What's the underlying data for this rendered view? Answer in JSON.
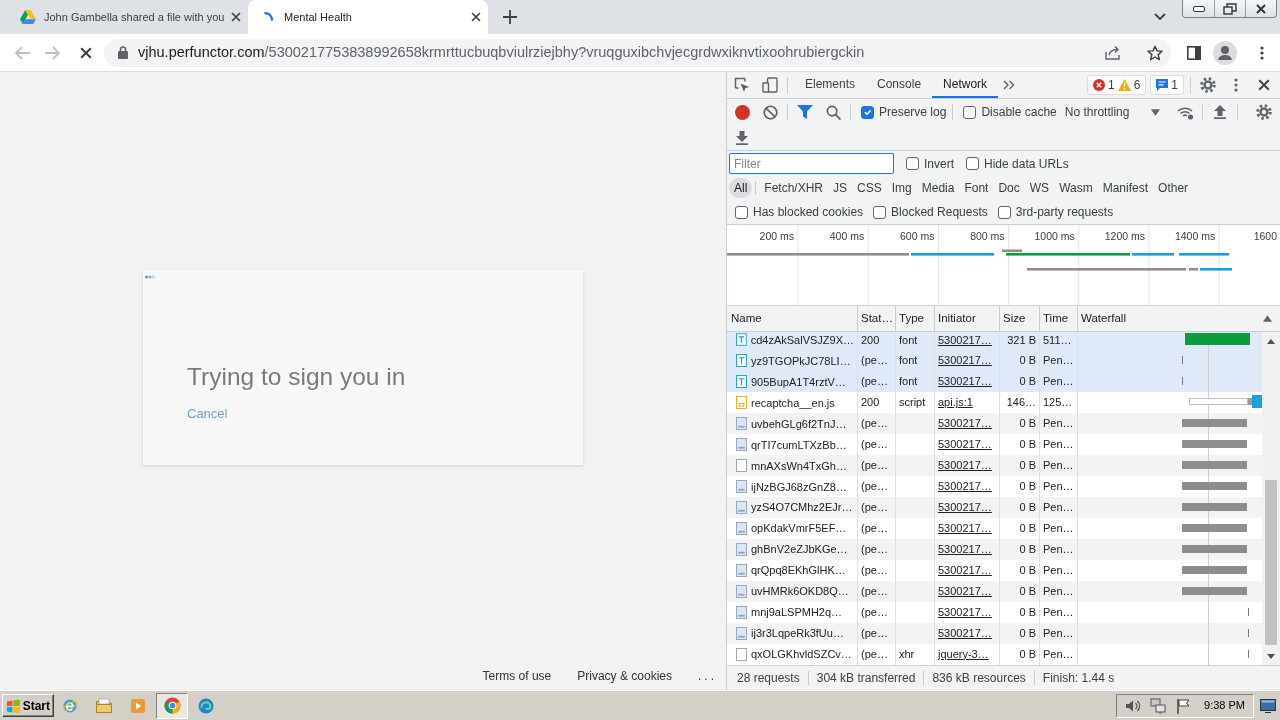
{
  "browser": {
    "tabs": [
      {
        "title": "John Gambella shared a file with you",
        "selected": false,
        "loading": false
      },
      {
        "title": "Mental Health",
        "selected": true,
        "loading": true
      }
    ],
    "nav": {
      "back": {
        "disabled": true
      },
      "forward": {
        "disabled": true
      },
      "loading": true
    },
    "address": {
      "host": "vjhu.perfunctor.com",
      "path": "/5300217753838992658krmrttucbuqbviulrziejbhy?vruqguxibchvjecgrdwxiknvtixoohrubiergckin"
    }
  },
  "page": {
    "status": "Trying to sign you in",
    "cancel": "Cancel",
    "footer": [
      "Terms of use",
      "Privacy & cookies",
      "..."
    ]
  },
  "devtools": {
    "panels": [
      {
        "label": "Elements",
        "selected": false
      },
      {
        "label": "Console",
        "selected": false
      },
      {
        "label": "Network",
        "selected": true
      }
    ],
    "issues": {
      "errors": "1",
      "warnings": "6",
      "messages": "1"
    },
    "toolbar": {
      "recording": true,
      "filter_active": true,
      "options": [
        {
          "label": "Preserve log",
          "checked": true
        },
        {
          "label": "Disable cache",
          "checked": false
        }
      ],
      "throttling": "No throttling"
    },
    "filter": {
      "placeholder": "Filter",
      "options": [
        {
          "label": "Invert",
          "checked": false
        },
        {
          "label": "Hide data URLs",
          "checked": false
        }
      ]
    },
    "types": [
      {
        "label": "All",
        "selected": true
      },
      {
        "label": "Fetch/XHR",
        "selected": false
      },
      {
        "label": "JS",
        "selected": false
      },
      {
        "label": "CSS",
        "selected": false
      },
      {
        "label": "Img",
        "selected": false
      },
      {
        "label": "Media",
        "selected": false
      },
      {
        "label": "Font",
        "selected": false
      },
      {
        "label": "Doc",
        "selected": false
      },
      {
        "label": "WS",
        "selected": false
      },
      {
        "label": "Wasm",
        "selected": false
      },
      {
        "label": "Manifest",
        "selected": false
      },
      {
        "label": "Other",
        "selected": false
      }
    ],
    "blocked_options": [
      {
        "label": "Has blocked cookies",
        "checked": false
      },
      {
        "label": "Blocked Requests",
        "checked": false
      },
      {
        "label": "3rd-party requests",
        "checked": false
      }
    ],
    "overview": {
      "ticks": [
        "200 ms",
        "400 ms",
        "600 ms",
        "800 ms",
        "1000 ms",
        "1200 ms",
        "1400 ms",
        "1600"
      ]
    },
    "table": {
      "columns": [
        "Name",
        "Stat…",
        "Type",
        "Initiator",
        "Size",
        "Time",
        "Waterfall"
      ],
      "rows": [
        {
          "kind": "font",
          "name": "cd4zAkSalVSJZ9X…",
          "status": "200",
          "type": "font",
          "initiator": "5300217…",
          "size": "321 B",
          "time": "511…",
          "highlighted": true,
          "waterfall": {
            "kind": "download"
          }
        },
        {
          "kind": "font",
          "name": "yz9TGOPkJC78LI…",
          "status": "(pe…",
          "type": "font",
          "initiator": "5300217…",
          "size": "0 B",
          "time": "Pen…",
          "highlighted": true,
          "waterfall": {
            "kind": "early-blip"
          }
        },
        {
          "kind": "font",
          "name": "905BupA1T4rztV…",
          "status": "(pe…",
          "type": "font",
          "initiator": "5300217…",
          "size": "0 B",
          "time": "Pen…",
          "highlighted": true,
          "waterfall": {
            "kind": "early-blip"
          }
        },
        {
          "kind": "script",
          "name": "recaptcha__en.js",
          "status": "200",
          "type": "script",
          "initiator": "api.js:1",
          "size": "146…",
          "time": "125…",
          "highlighted": false,
          "waterfall": {
            "kind": "script"
          }
        },
        {
          "kind": "document",
          "name": "uvbehGLg6f2TnJ…",
          "status": "(pe…",
          "initiator": "5300217…",
          "size": "0 B",
          "time": "Pen…",
          "highlighted": false,
          "waterfall": {
            "kind": "pending"
          }
        },
        {
          "kind": "document",
          "name": "qrTI7cumLTXzBb…",
          "status": "(pe…",
          "initiator": "5300217…",
          "size": "0 B",
          "time": "Pen…",
          "highlighted": false,
          "waterfall": {
            "kind": "pending"
          }
        },
        {
          "kind": "other",
          "name": "mnAXsWn4TxGh…",
          "status": "(pe…",
          "initiator": "5300217…",
          "size": "0 B",
          "time": "Pen…",
          "highlighted": false,
          "waterfall": {
            "kind": "pending"
          }
        },
        {
          "kind": "document",
          "name": "ijNzBGJ68zGnZ8…",
          "status": "(pe…",
          "initiator": "5300217…",
          "size": "0 B",
          "time": "Pen…",
          "highlighted": false,
          "waterfall": {
            "kind": "pending"
          }
        },
        {
          "kind": "document",
          "name": "yzS4O7CMhz2EJr…",
          "status": "(pe…",
          "initiator": "5300217…",
          "size": "0 B",
          "time": "Pen…",
          "highlighted": false,
          "waterfall": {
            "kind": "pending"
          }
        },
        {
          "kind": "document",
          "name": "opKdakVmrF5EF…",
          "status": "(pe…",
          "initiator": "5300217…",
          "size": "0 B",
          "time": "Pen…",
          "highlighted": false,
          "waterfall": {
            "kind": "pending"
          }
        },
        {
          "kind": "document",
          "name": "ghBnV2eZJbKGe…",
          "status": "(pe…",
          "initiator": "5300217…",
          "size": "0 B",
          "time": "Pen…",
          "highlighted": false,
          "waterfall": {
            "kind": "pending"
          }
        },
        {
          "kind": "document",
          "name": "qrQpq8EKhGlHK…",
          "status": "(pe…",
          "initiator": "5300217…",
          "size": "0 B",
          "time": "Pen…",
          "highlighted": false,
          "waterfall": {
            "kind": "pending"
          }
        },
        {
          "kind": "document",
          "name": "uvHMRk6OKD8Q…",
          "status": "(pe…",
          "initiator": "5300217…",
          "size": "0 B",
          "time": "Pen…",
          "highlighted": false,
          "waterfall": {
            "kind": "pending"
          }
        },
        {
          "kind": "document",
          "name": "mnj9aLSPMH2q…",
          "status": "(pe…",
          "initiator": "5300217…",
          "size": "0 B",
          "time": "Pen…",
          "highlighted": false,
          "waterfall": {
            "kind": "late-blip"
          }
        },
        {
          "kind": "document",
          "name": "ij3r3LqpeRk3fUu…",
          "status": "(pe…",
          "initiator": "5300217…",
          "size": "0 B",
          "time": "Pen…",
          "highlighted": false,
          "waterfall": {
            "kind": "late-blip"
          }
        },
        {
          "kind": "other",
          "name": "qxOLGKhvldSZCv…",
          "status": "(pe…",
          "type": "xhr",
          "initiator": "jquery-3…",
          "size": "0 B",
          "time": "Pen…",
          "highlighted": false,
          "waterfall": {
            "kind": "late-blip"
          }
        }
      ]
    },
    "summary": [
      "28 requests",
      "304 kB transferred",
      "836 kB resources",
      "Finish: 1.44 s"
    ]
  },
  "taskbar": {
    "start": "Start",
    "apps": [
      {
        "kind": "e-globe",
        "active": false
      },
      {
        "kind": "folder",
        "active": false
      },
      {
        "kind": "player",
        "active": false
      },
      {
        "kind": "ring-logo",
        "active": true
      },
      {
        "kind": "wave-logo",
        "active": false
      }
    ],
    "clock": "9:38 PM"
  }
}
